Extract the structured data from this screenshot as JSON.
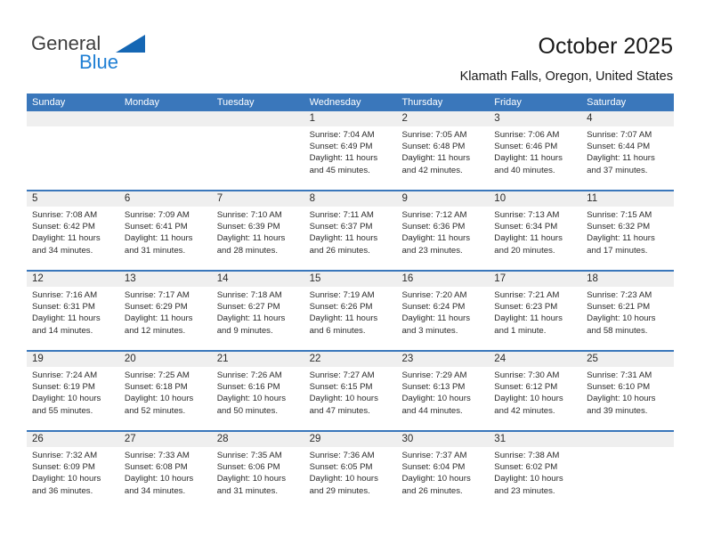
{
  "brand": {
    "name_part1": "General",
    "name_part2": "Blue",
    "triangle_icon": "triangle-icon"
  },
  "header": {
    "title": "October 2025",
    "subtitle": "Klamath Falls, Oregon, United States"
  },
  "colors": {
    "header_blue": "#3a77bb",
    "brand_blue": "#1f7fd4",
    "day_band_gray": "#efefef",
    "text": "#2b2b2b"
  },
  "calendar": {
    "weekday_headers": [
      "Sunday",
      "Monday",
      "Tuesday",
      "Wednesday",
      "Thursday",
      "Friday",
      "Saturday"
    ],
    "weeks": [
      [
        {
          "empty": true
        },
        {
          "empty": true
        },
        {
          "empty": true
        },
        {
          "day": "1",
          "sunrise": "Sunrise: 7:04 AM",
          "sunset": "Sunset: 6:49 PM",
          "daylight1": "Daylight: 11 hours",
          "daylight2": "and 45 minutes."
        },
        {
          "day": "2",
          "sunrise": "Sunrise: 7:05 AM",
          "sunset": "Sunset: 6:48 PM",
          "daylight1": "Daylight: 11 hours",
          "daylight2": "and 42 minutes."
        },
        {
          "day": "3",
          "sunrise": "Sunrise: 7:06 AM",
          "sunset": "Sunset: 6:46 PM",
          "daylight1": "Daylight: 11 hours",
          "daylight2": "and 40 minutes."
        },
        {
          "day": "4",
          "sunrise": "Sunrise: 7:07 AM",
          "sunset": "Sunset: 6:44 PM",
          "daylight1": "Daylight: 11 hours",
          "daylight2": "and 37 minutes."
        }
      ],
      [
        {
          "day": "5",
          "sunrise": "Sunrise: 7:08 AM",
          "sunset": "Sunset: 6:42 PM",
          "daylight1": "Daylight: 11 hours",
          "daylight2": "and 34 minutes."
        },
        {
          "day": "6",
          "sunrise": "Sunrise: 7:09 AM",
          "sunset": "Sunset: 6:41 PM",
          "daylight1": "Daylight: 11 hours",
          "daylight2": "and 31 minutes."
        },
        {
          "day": "7",
          "sunrise": "Sunrise: 7:10 AM",
          "sunset": "Sunset: 6:39 PM",
          "daylight1": "Daylight: 11 hours",
          "daylight2": "and 28 minutes."
        },
        {
          "day": "8",
          "sunrise": "Sunrise: 7:11 AM",
          "sunset": "Sunset: 6:37 PM",
          "daylight1": "Daylight: 11 hours",
          "daylight2": "and 26 minutes."
        },
        {
          "day": "9",
          "sunrise": "Sunrise: 7:12 AM",
          "sunset": "Sunset: 6:36 PM",
          "daylight1": "Daylight: 11 hours",
          "daylight2": "and 23 minutes."
        },
        {
          "day": "10",
          "sunrise": "Sunrise: 7:13 AM",
          "sunset": "Sunset: 6:34 PM",
          "daylight1": "Daylight: 11 hours",
          "daylight2": "and 20 minutes."
        },
        {
          "day": "11",
          "sunrise": "Sunrise: 7:15 AM",
          "sunset": "Sunset: 6:32 PM",
          "daylight1": "Daylight: 11 hours",
          "daylight2": "and 17 minutes."
        }
      ],
      [
        {
          "day": "12",
          "sunrise": "Sunrise: 7:16 AM",
          "sunset": "Sunset: 6:31 PM",
          "daylight1": "Daylight: 11 hours",
          "daylight2": "and 14 minutes."
        },
        {
          "day": "13",
          "sunrise": "Sunrise: 7:17 AM",
          "sunset": "Sunset: 6:29 PM",
          "daylight1": "Daylight: 11 hours",
          "daylight2": "and 12 minutes."
        },
        {
          "day": "14",
          "sunrise": "Sunrise: 7:18 AM",
          "sunset": "Sunset: 6:27 PM",
          "daylight1": "Daylight: 11 hours",
          "daylight2": "and 9 minutes."
        },
        {
          "day": "15",
          "sunrise": "Sunrise: 7:19 AM",
          "sunset": "Sunset: 6:26 PM",
          "daylight1": "Daylight: 11 hours",
          "daylight2": "and 6 minutes."
        },
        {
          "day": "16",
          "sunrise": "Sunrise: 7:20 AM",
          "sunset": "Sunset: 6:24 PM",
          "daylight1": "Daylight: 11 hours",
          "daylight2": "and 3 minutes."
        },
        {
          "day": "17",
          "sunrise": "Sunrise: 7:21 AM",
          "sunset": "Sunset: 6:23 PM",
          "daylight1": "Daylight: 11 hours",
          "daylight2": "and 1 minute."
        },
        {
          "day": "18",
          "sunrise": "Sunrise: 7:23 AM",
          "sunset": "Sunset: 6:21 PM",
          "daylight1": "Daylight: 10 hours",
          "daylight2": "and 58 minutes."
        }
      ],
      [
        {
          "day": "19",
          "sunrise": "Sunrise: 7:24 AM",
          "sunset": "Sunset: 6:19 PM",
          "daylight1": "Daylight: 10 hours",
          "daylight2": "and 55 minutes."
        },
        {
          "day": "20",
          "sunrise": "Sunrise: 7:25 AM",
          "sunset": "Sunset: 6:18 PM",
          "daylight1": "Daylight: 10 hours",
          "daylight2": "and 52 minutes."
        },
        {
          "day": "21",
          "sunrise": "Sunrise: 7:26 AM",
          "sunset": "Sunset: 6:16 PM",
          "daylight1": "Daylight: 10 hours",
          "daylight2": "and 50 minutes."
        },
        {
          "day": "22",
          "sunrise": "Sunrise: 7:27 AM",
          "sunset": "Sunset: 6:15 PM",
          "daylight1": "Daylight: 10 hours",
          "daylight2": "and 47 minutes."
        },
        {
          "day": "23",
          "sunrise": "Sunrise: 7:29 AM",
          "sunset": "Sunset: 6:13 PM",
          "daylight1": "Daylight: 10 hours",
          "daylight2": "and 44 minutes."
        },
        {
          "day": "24",
          "sunrise": "Sunrise: 7:30 AM",
          "sunset": "Sunset: 6:12 PM",
          "daylight1": "Daylight: 10 hours",
          "daylight2": "and 42 minutes."
        },
        {
          "day": "25",
          "sunrise": "Sunrise: 7:31 AM",
          "sunset": "Sunset: 6:10 PM",
          "daylight1": "Daylight: 10 hours",
          "daylight2": "and 39 minutes."
        }
      ],
      [
        {
          "day": "26",
          "sunrise": "Sunrise: 7:32 AM",
          "sunset": "Sunset: 6:09 PM",
          "daylight1": "Daylight: 10 hours",
          "daylight2": "and 36 minutes."
        },
        {
          "day": "27",
          "sunrise": "Sunrise: 7:33 AM",
          "sunset": "Sunset: 6:08 PM",
          "daylight1": "Daylight: 10 hours",
          "daylight2": "and 34 minutes."
        },
        {
          "day": "28",
          "sunrise": "Sunrise: 7:35 AM",
          "sunset": "Sunset: 6:06 PM",
          "daylight1": "Daylight: 10 hours",
          "daylight2": "and 31 minutes."
        },
        {
          "day": "29",
          "sunrise": "Sunrise: 7:36 AM",
          "sunset": "Sunset: 6:05 PM",
          "daylight1": "Daylight: 10 hours",
          "daylight2": "and 29 minutes."
        },
        {
          "day": "30",
          "sunrise": "Sunrise: 7:37 AM",
          "sunset": "Sunset: 6:04 PM",
          "daylight1": "Daylight: 10 hours",
          "daylight2": "and 26 minutes."
        },
        {
          "day": "31",
          "sunrise": "Sunrise: 7:38 AM",
          "sunset": "Sunset: 6:02 PM",
          "daylight1": "Daylight: 10 hours",
          "daylight2": "and 23 minutes."
        },
        {
          "empty": true
        }
      ]
    ]
  }
}
